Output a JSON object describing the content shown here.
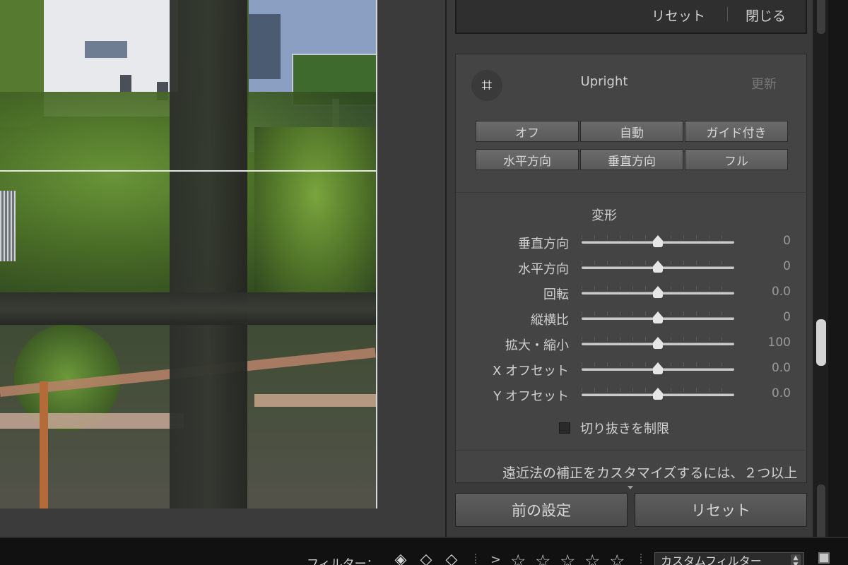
{
  "top_box": {
    "reset_label": "リセット",
    "close_label": "閉じる"
  },
  "upright": {
    "icon": "upright-grid-icon",
    "icon_glyph": "⌗",
    "title": "Upright",
    "update_label": "更新",
    "row1": [
      "オフ",
      "自動",
      "ガイド付き"
    ],
    "row2": [
      "水平方向",
      "垂直方向",
      "フル"
    ]
  },
  "transform": {
    "heading": "変形",
    "sliders": [
      {
        "label": "垂直方向",
        "value": "0",
        "position": 0.5
      },
      {
        "label": "水平方向",
        "value": "0",
        "position": 0.5
      },
      {
        "label": "回転",
        "value": "0.0",
        "position": 0.5
      },
      {
        "label": "縦横比",
        "value": "0",
        "position": 0.5
      },
      {
        "label": "拡大・縮小",
        "value": "100",
        "position": 0.5
      },
      {
        "label": "X オフセット",
        "value": "0.0",
        "position": 0.5
      },
      {
        "label": "Y オフセット",
        "value": "0.0",
        "position": 0.5
      }
    ],
    "constrain_label": "切り抜きを制限",
    "constrain_checked": false,
    "hint": "遠近法の補正をカスタマイズするには、２つ以上"
  },
  "buttons": {
    "previous": "前の設定",
    "reset": "リセット"
  },
  "filter_bar": {
    "label": "フィルター：",
    "flags": [
      "flag-pick-icon",
      "flag-unpick-icon",
      "flag-reject-icon"
    ],
    "rating_operator": ">",
    "star_count": 5,
    "select_value": "カスタムフィルター"
  },
  "colors": {
    "panel_bg": "#444444",
    "app_bg": "#3a3a3a",
    "text": "#cfcfcf"
  }
}
